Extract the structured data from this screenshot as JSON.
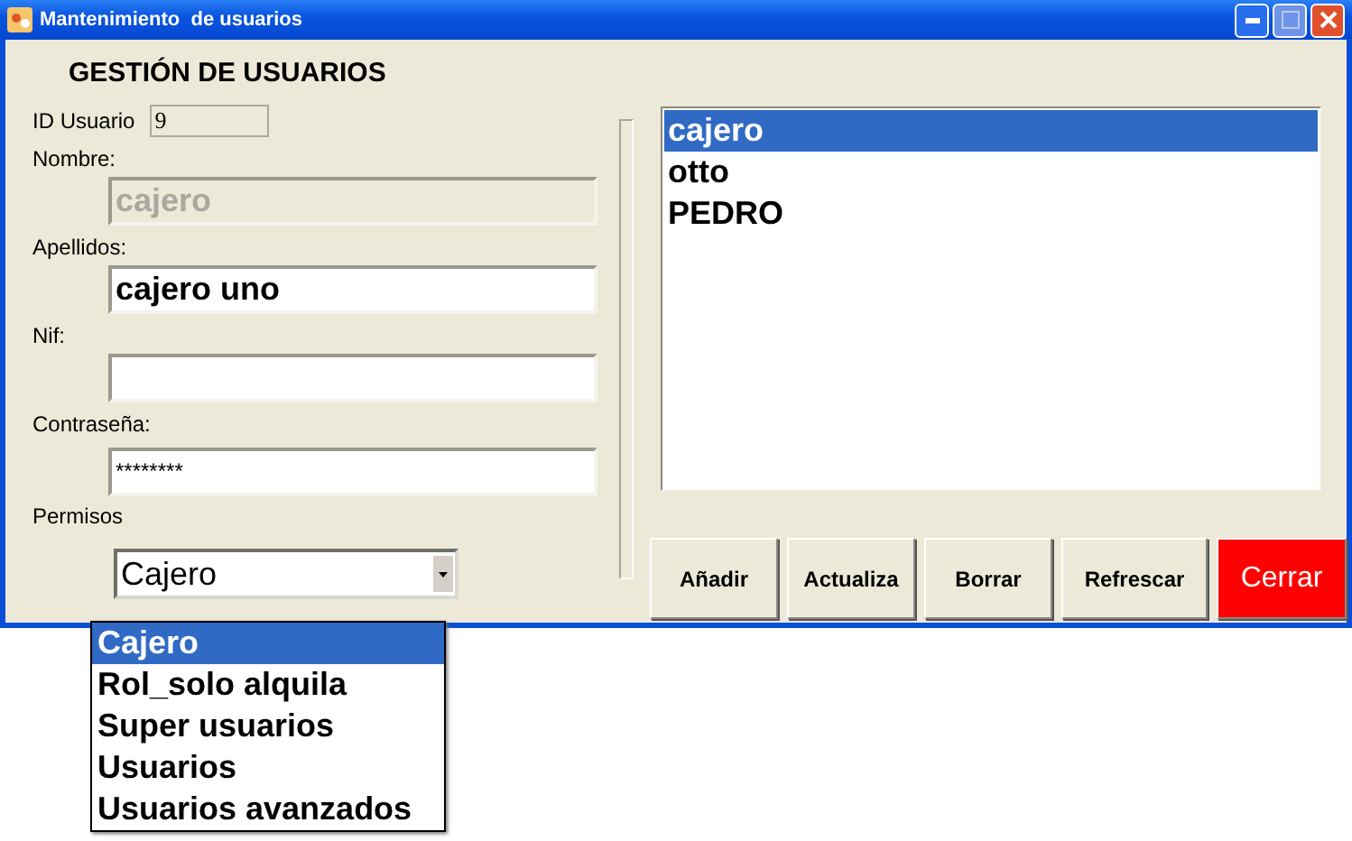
{
  "window": {
    "title": "Mantenimiento  de usuarios"
  },
  "heading": "GESTIÓN DE USUARIOS",
  "fields": [
    {
      "kind": "id",
      "label": "ID Usuario",
      "value": "9",
      "disabled": true
    },
    {
      "kind": "text",
      "label": "Nombre:",
      "value": "cajero",
      "disabled": true
    },
    {
      "kind": "text",
      "label": "Apellidos:",
      "value": "cajero uno",
      "disabled": false
    },
    {
      "kind": "text",
      "label": "Nif:",
      "disabled": false
    },
    {
      "kind": "password",
      "label": "Contraseña:",
      "value": "********",
      "disabled": false
    }
  ],
  "permisos": {
    "label": "Permisos",
    "value": "Cajero",
    "expanded": true,
    "options": [
      {
        "label": "Cajero",
        "selected": true
      },
      {
        "label": "Rol_solo alquila",
        "selected": false
      },
      {
        "label": "Super usuarios",
        "selected": false
      },
      {
        "label": "Usuarios",
        "selected": false
      },
      {
        "label": "Usuarios avanzados",
        "selected": false
      }
    ]
  },
  "users": [
    {
      "label": "cajero",
      "selected": true
    },
    {
      "label": "otto",
      "selected": false
    },
    {
      "label": "PEDRO",
      "selected": false
    }
  ],
  "buttons": [
    {
      "label": "Añadir",
      "kind": "normal"
    },
    {
      "label": "Actualiza",
      "kind": "normal"
    },
    {
      "label": "Borrar",
      "kind": "normal"
    },
    {
      "label": "Refrescar",
      "kind": "normal"
    },
    {
      "label": "Cerrar",
      "kind": "danger"
    }
  ]
}
